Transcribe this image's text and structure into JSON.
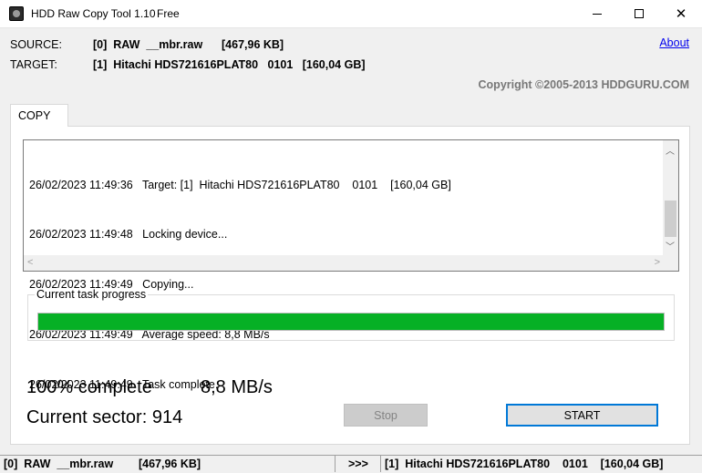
{
  "window": {
    "title": "HDD Raw Copy Tool 1.10",
    "edition": "Free",
    "icons": [
      "drive-icon",
      "minimize-icon",
      "maximize-icon",
      "close-icon"
    ]
  },
  "header": {
    "source_label": "SOURCE:",
    "source_value": "[0]  RAW  __mbr.raw      [467,96 KB]",
    "target_label": "TARGET:",
    "target_value": "[1]  Hitachi HDS721616PLAT80   0101   [160,04 GB]",
    "about_link": "About",
    "copyright": "Copyright ©2005-2013 HDDGURU.COM"
  },
  "tabs": [
    {
      "label": "COPY",
      "active": true
    }
  ],
  "log": {
    "lines": [
      "26/02/2023 11:49:36   Target: [1]  Hitachi HDS721616PLAT80    0101    [160,04 GB]",
      "26/02/2023 11:49:48   Locking device...",
      "26/02/2023 11:49:49   Copying...",
      "26/02/2023 11:49:49   Average speed: 8,8 MB/s",
      "26/02/2023 11:49:49   Task complete."
    ]
  },
  "progress": {
    "group_label": "Current task progress",
    "percent": 100,
    "bar_color": "#06b025"
  },
  "stats": {
    "complete_text": "100% complete",
    "speed_text": "8,8 MB/s",
    "sector_text": "Current sector: 914"
  },
  "buttons": {
    "stop_label": "Stop",
    "stop_enabled": false,
    "start_label": "START"
  },
  "statusbar": {
    "source": "[0]  RAW  __mbr.raw        [467,96 KB]",
    "arrow": ">>>",
    "target": "[1]  Hitachi HDS721616PLAT80    0101    [160,04 GB]"
  }
}
